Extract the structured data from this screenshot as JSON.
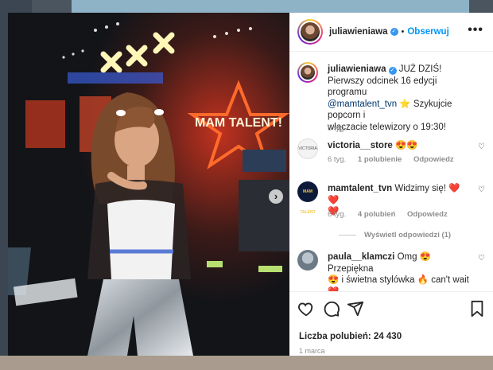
{
  "post": {
    "username": "juliawieniawa",
    "follow_label": "Obserwuj",
    "dot": "•",
    "more": "•••",
    "caption_username": "juliawieniawa",
    "caption_line1": "JUŻ DZIŚ!",
    "caption_line2": "Pierwszy odcinek 16 edycji programu",
    "caption_mention": "@mamtalent_tvn",
    "caption_line3_rest": "⭐ Szykujcie popcorn i",
    "caption_line4": "włączacie telewizory o 19:30!",
    "caption_time": "6 tyg.",
    "likes_text": "Liczba polubień: 24 430",
    "date": "1 marca",
    "photo_sign": "MAM TALENT!"
  },
  "comments": [
    {
      "username": "victoria__store",
      "text": "😍😍",
      "time": "6 tyg.",
      "likes": "1 polubienie",
      "reply": "Odpowiedz",
      "avatar_label": "VICTORIA"
    },
    {
      "username": "mamtalent_tvn",
      "text": "Widzimy się! ❤️❤️",
      "text_line2": "❤️",
      "time": "6 tyg.",
      "likes": "4 polubień",
      "reply": "Odpowiedz",
      "view_replies": "Wyświetl odpowiedzi (1)",
      "avatar_label": "MAM TALENT"
    },
    {
      "username": "paula__klamczi",
      "text": "Omg 😍 Przepiękna",
      "text_line2": "😍 i świetna stylówka 🔥 can't wait",
      "text_line3": "❤️"
    }
  ],
  "icons": {
    "like": "heart-icon",
    "comment": "comment-icon",
    "share": "share-icon",
    "save": "bookmark-icon",
    "next": "chevron-right-icon",
    "verified": "verified-badge-icon"
  },
  "colors": {
    "accent": "#0095f6",
    "verified": "#3897f0",
    "text": "#262626",
    "muted": "#8e8e8e"
  }
}
